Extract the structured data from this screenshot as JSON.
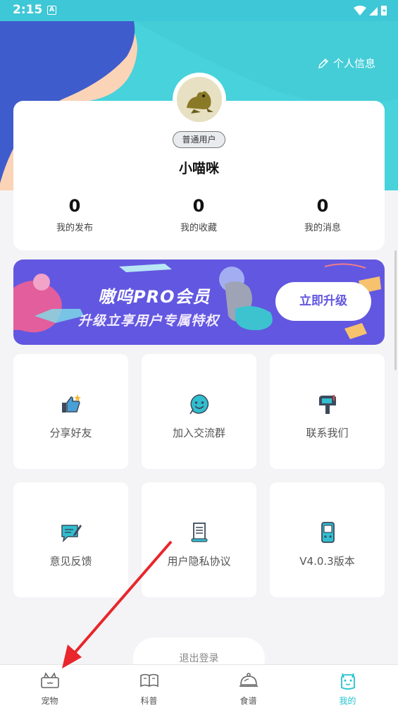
{
  "status_bar": {
    "time": "2:15",
    "a_label": "A"
  },
  "header": {
    "edit_profile_label": "个人信息"
  },
  "profile": {
    "badge": "普通用户",
    "username": "小喵咪",
    "stats": [
      {
        "value": "0",
        "label": "我的发布"
      },
      {
        "value": "0",
        "label": "我的收藏"
      },
      {
        "value": "0",
        "label": "我的消息"
      }
    ]
  },
  "banner": {
    "title": "嗷呜PRO会员",
    "subtitle": "升级立享用户专属特权",
    "button": "立即升级"
  },
  "menu": [
    {
      "label": "分享好友",
      "icon": "thumbs-up-icon"
    },
    {
      "label": "加入交流群",
      "icon": "smiley-chat-icon"
    },
    {
      "label": "联系我们",
      "icon": "mailbox-icon"
    },
    {
      "label": "意见反馈",
      "icon": "feedback-icon"
    },
    {
      "label": "用户隐私协议",
      "icon": "scroll-icon"
    },
    {
      "label": "V4.0.3版本",
      "icon": "device-icon"
    }
  ],
  "logout": "退出登录",
  "bottom_nav": [
    {
      "label": "宠物",
      "icon": "pet-icon",
      "active": false
    },
    {
      "label": "科普",
      "icon": "book-icon",
      "active": false
    },
    {
      "label": "食谱",
      "icon": "cloche-icon",
      "active": false
    },
    {
      "label": "我的",
      "icon": "profile-icon",
      "active": true
    }
  ],
  "colors": {
    "header_teal": "#48d2db",
    "banner_purple": "#6257e0",
    "accent": "#22c3cf",
    "annotation_arrow": "#e8262b"
  }
}
